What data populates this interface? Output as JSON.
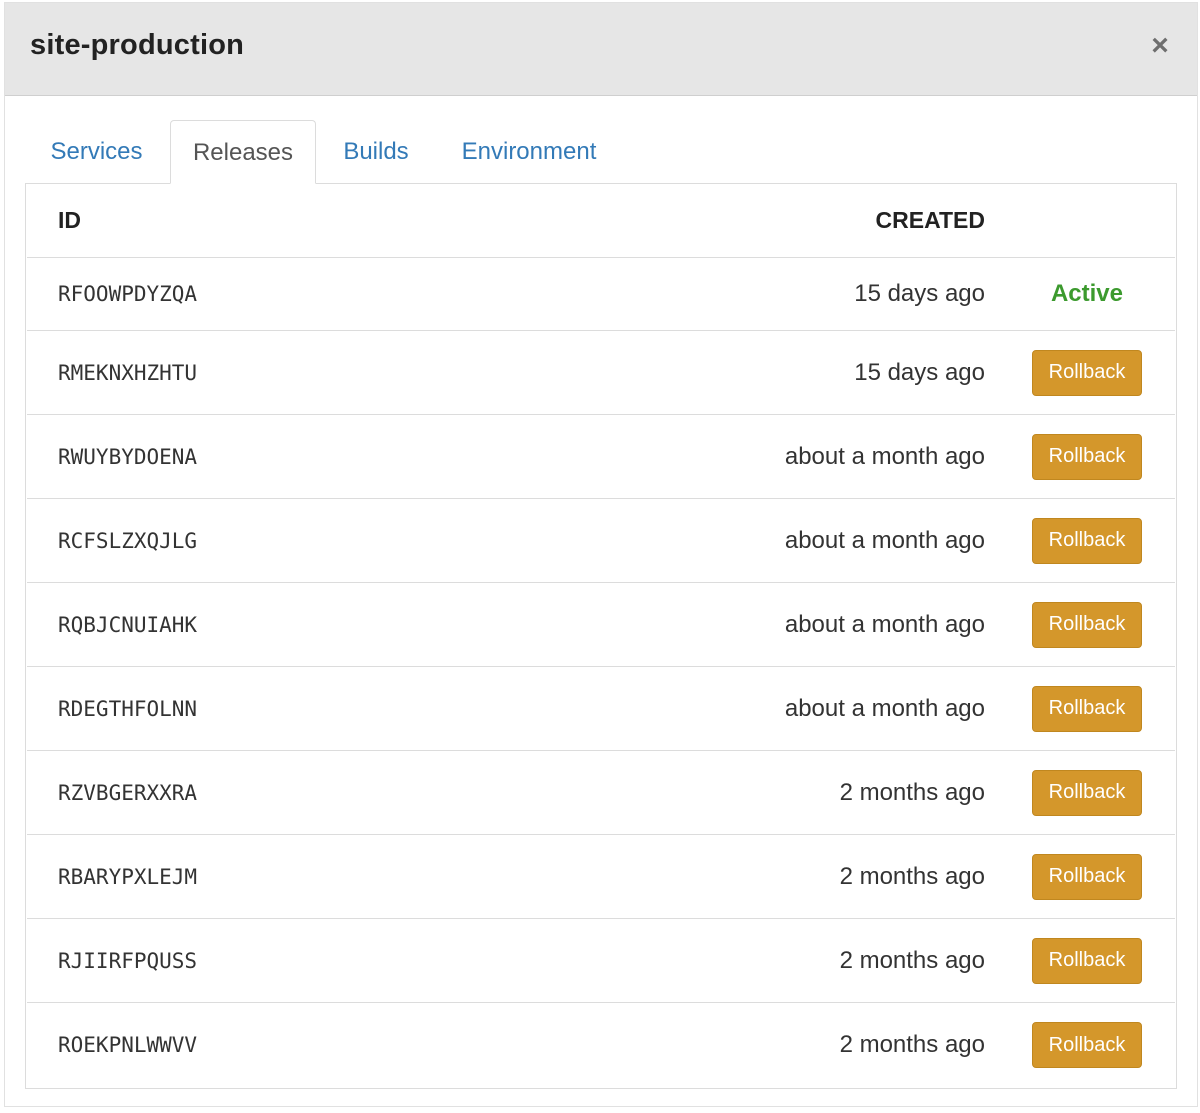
{
  "modal": {
    "title": "site-production",
    "close_label": "×"
  },
  "tabs": [
    {
      "label": "Services",
      "active": false
    },
    {
      "label": "Releases",
      "active": true
    },
    {
      "label": "Builds",
      "active": false
    },
    {
      "label": "Environment",
      "active": false
    }
  ],
  "table": {
    "headers": {
      "id": "ID",
      "created": "CREATED"
    },
    "rows": [
      {
        "id": "RFOOWPDYZQA",
        "created": "15 days ago",
        "status": "Active"
      },
      {
        "id": "RMEKNXHZHTU",
        "created": "15 days ago",
        "action": "Rollback"
      },
      {
        "id": "RWUYBYDOENA",
        "created": "about a month ago",
        "action": "Rollback"
      },
      {
        "id": "RCFSLZXQJLG",
        "created": "about a month ago",
        "action": "Rollback"
      },
      {
        "id": "RQBJCNUIAHK",
        "created": "about a month ago",
        "action": "Rollback"
      },
      {
        "id": "RDEGTHFOLNN",
        "created": "about a month ago",
        "action": "Rollback"
      },
      {
        "id": "RZVBGERXXRA",
        "created": "2 months ago",
        "action": "Rollback"
      },
      {
        "id": "RBARYPXLEJM",
        "created": "2 months ago",
        "action": "Rollback"
      },
      {
        "id": "RJIIRFPQUSS",
        "created": "2 months ago",
        "action": "Rollback"
      },
      {
        "id": "ROEKPNLWWVV",
        "created": "2 months ago",
        "action": "Rollback"
      }
    ]
  },
  "colors": {
    "header_bg": "#e6e6e6",
    "tab_link": "#337ab7",
    "active_status": "#3c9a2e",
    "rollback_button": "#d4972b"
  }
}
